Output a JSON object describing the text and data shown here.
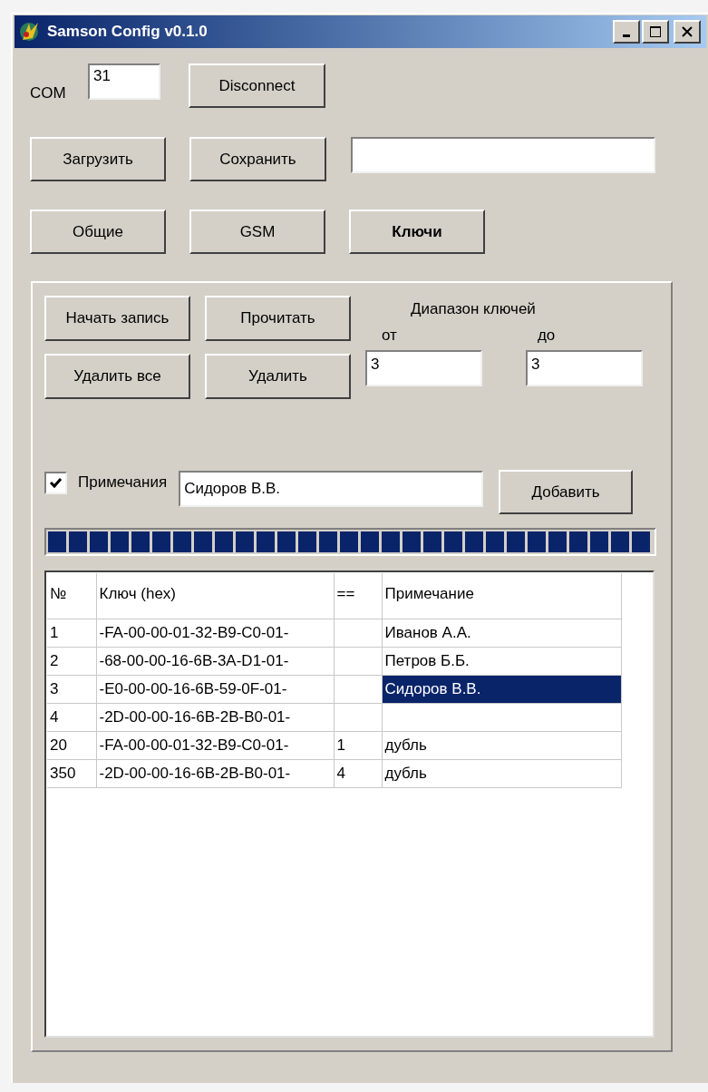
{
  "window": {
    "title": "Samson Config v0.1.0"
  },
  "connection": {
    "label": "COM",
    "port": "31",
    "button": "Disconnect"
  },
  "file": {
    "buttons": [
      "Загрузить",
      "Сохранить"
    ]
  },
  "tabs": [
    {
      "label": "Общие",
      "selected": false
    },
    {
      "label": "GSM",
      "selected": false
    },
    {
      "label": "Ключи",
      "selected": true
    }
  ],
  "keys_panel": {
    "buttons": [
      "Начать запись",
      "Прочитать",
      "Удалить все",
      "Удалить"
    ],
    "range": {
      "title": "Диапазон ключей",
      "from_label": "от",
      "to_label": "до",
      "from": "3",
      "to": "3"
    },
    "notes": {
      "label": "Примечания",
      "checked": true,
      "value": "Сидоров В.В.",
      "button": "Добавить"
    },
    "progress": {
      "level": 1
    },
    "table": {
      "columns": [
        "№",
        "Ключ (hex)",
        "==",
        "Примечание"
      ],
      "rows": [
        {
          "cells": [
            "1",
            "-FA-00-00-01-32-B9-C0-01-",
            "",
            "Иванов А.А."
          ],
          "selected": false
        },
        {
          "cells": [
            "2",
            "-68-00-00-16-6B-3A-D1-01-",
            "",
            "Петров Б.Б."
          ],
          "selected": false
        },
        {
          "cells": [
            "3",
            "-E0-00-00-16-6B-59-0F-01-",
            "",
            "Сидоров В.В."
          ],
          "selected": true
        },
        {
          "cells": [
            "4",
            "-2D-00-00-16-6B-2B-B0-01-",
            "",
            ""
          ],
          "selected": false
        },
        {
          "cells": [
            "20",
            "-FA-00-00-01-32-B9-C0-01-",
            "1",
            "дубль"
          ],
          "selected": false
        },
        {
          "cells": [
            "350",
            "-2D-00-00-16-6B-2B-B0-01-",
            "4",
            "дубль"
          ],
          "selected": false
        }
      ]
    }
  }
}
